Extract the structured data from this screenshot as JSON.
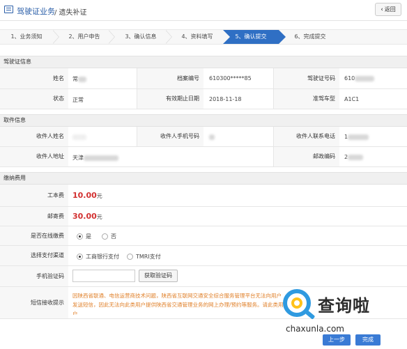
{
  "header": {
    "title": "驾驶证业务",
    "subtitle": "/ 遗失补证",
    "back_label": "返回"
  },
  "steps": [
    {
      "label": "1、业务须知",
      "active": false
    },
    {
      "label": "2、用户申告",
      "active": false
    },
    {
      "label": "3、确认信息",
      "active": false
    },
    {
      "label": "4、资料填写",
      "active": false
    },
    {
      "label": "5、确认提交",
      "active": true
    },
    {
      "label": "6、完成提交",
      "active": false
    }
  ],
  "license": {
    "section_title": "驾驶证信息",
    "name_label": "姓名",
    "name_value": "常",
    "archive_label": "档案编号",
    "archive_value": "610300*****85",
    "license_no_label": "驾驶证号码",
    "license_no_value": "610",
    "status_label": "状态",
    "status_value": "正常",
    "expiry_label": "有效期止日期",
    "expiry_value": "2018-11-18",
    "class_label": "准驾车型",
    "class_value": "A1C1"
  },
  "pickup": {
    "section_title": "取件信息",
    "recipient_label": "收件人姓名",
    "phone_label": "收件人手机号码",
    "contact_label": "收件人联系电话",
    "contact_value": "1",
    "address_label": "收件人地址",
    "address_value": "天津",
    "postcode_label": "邮政编码",
    "postcode_value": "2"
  },
  "fees": {
    "section_title": "缴纳费用",
    "work_fee_label": "工本费",
    "work_fee_value": "10.00",
    "postage_label": "邮寄费",
    "postage_value": "30.00",
    "unit": "元",
    "online_label": "是否在线缴费",
    "online_yes": "是",
    "online_no": "否",
    "channel_label": "选择支付渠道",
    "channel_icbc": "工商银行支付",
    "channel_tmri": "TMRI支付",
    "verify_label": "手机验证码",
    "verify_button": "获取验证码",
    "sms_label": "短信接收提示",
    "sms_notice": "因陕西省联通、电信运营商技术问题，陕西省互联网交通安全综合服务管理平台无法向用户发送短信，因此无法向此类用户提供陕西省交通管理业务的网上办理/预约等服务。请此类用户"
  },
  "footer": {
    "prev_label": "上一步",
    "done_label": "完成"
  },
  "watermark": {
    "text": "查询啦",
    "url": "chaxunla.com"
  }
}
